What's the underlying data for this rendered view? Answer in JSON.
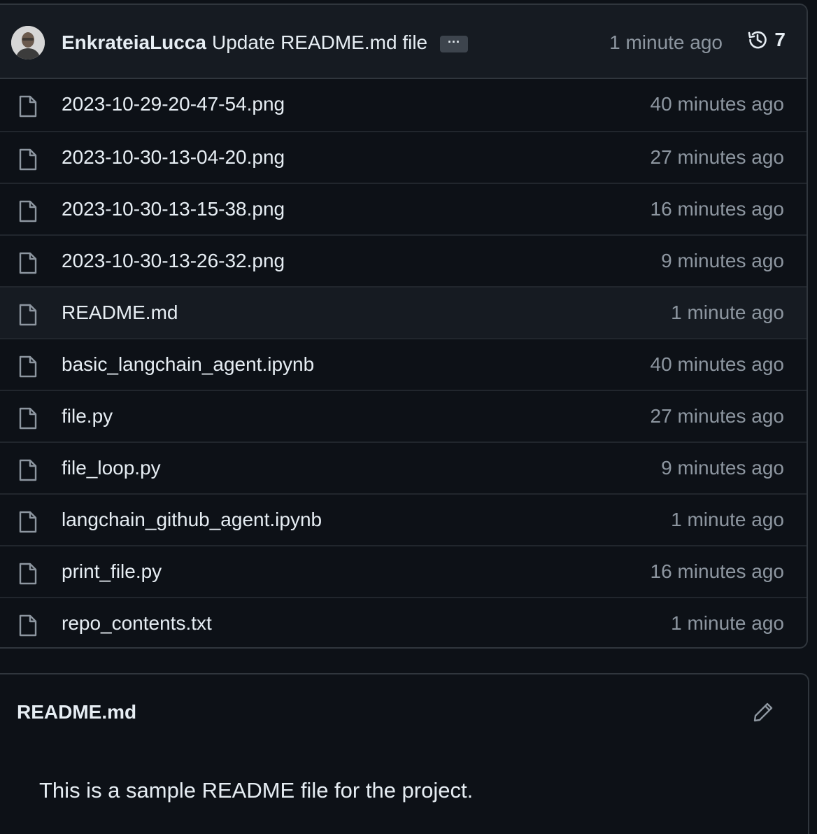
{
  "commit": {
    "author": "EnkrateiaLucca",
    "message": "Update README.md file",
    "ellipsis": "···",
    "time": "1 minute ago",
    "history_icon": "history-icon",
    "history_count": "7"
  },
  "files": [
    {
      "name": "2023-10-29-20-47-54.png",
      "time": "40 minutes ago",
      "icon": "file-icon"
    },
    {
      "name": "2023-10-30-13-04-20.png",
      "time": "27 minutes ago",
      "icon": "file-icon"
    },
    {
      "name": "2023-10-30-13-15-38.png",
      "time": "16 minutes ago",
      "icon": "file-icon"
    },
    {
      "name": "2023-10-30-13-26-32.png",
      "time": "9 minutes ago",
      "icon": "file-icon"
    },
    {
      "name": "README.md",
      "time": "1 minute ago",
      "icon": "file-icon",
      "hovered": true
    },
    {
      "name": "basic_langchain_agent.ipynb",
      "time": "40 minutes ago",
      "icon": "file-icon"
    },
    {
      "name": "file.py",
      "time": "27 minutes ago",
      "icon": "file-icon"
    },
    {
      "name": "file_loop.py",
      "time": "9 minutes ago",
      "icon": "file-icon"
    },
    {
      "name": "langchain_github_agent.ipynb",
      "time": "1 minute ago",
      "icon": "file-icon"
    },
    {
      "name": "print_file.py",
      "time": "16 minutes ago",
      "icon": "file-icon"
    },
    {
      "name": "repo_contents.txt",
      "time": "1 minute ago",
      "icon": "file-icon"
    }
  ],
  "readme": {
    "title": "README.md",
    "edit_icon": "pencil-icon",
    "body": "This is a sample README file for the project."
  },
  "colors": {
    "background": "#0d1117",
    "header_bg": "#161b22",
    "border": "#30363d",
    "text": "#e6edf3",
    "muted": "#8d96a0"
  }
}
